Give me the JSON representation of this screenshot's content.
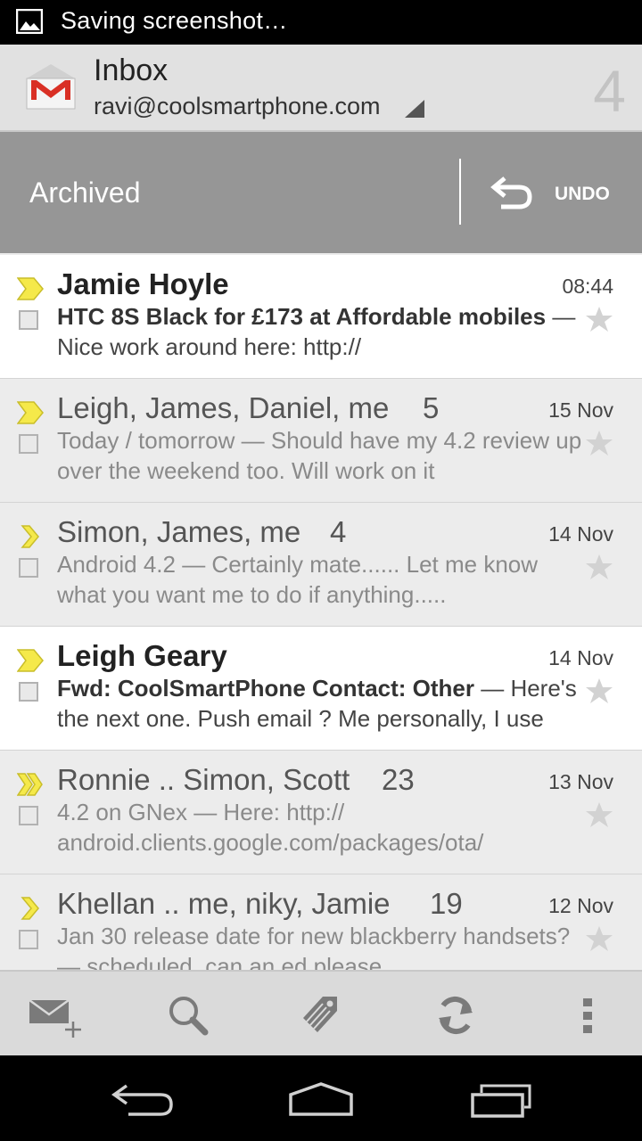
{
  "status_bar": {
    "notification_text": "Saving screenshot…"
  },
  "header": {
    "title": "Inbox",
    "account": "ravi@coolsmartphone.com",
    "unread_count": "4"
  },
  "undo_bar": {
    "message": "Archived",
    "undo_label": "UNDO"
  },
  "conversations": [
    {
      "sender": "Jamie Hoyle",
      "count": "",
      "date": "08:44",
      "subject": "HTC 8S Black for £173 at Affordable mobiles",
      "snippet": " — Nice work around here: http://",
      "unread": true,
      "importance": "single"
    },
    {
      "sender": "Leigh, James, Daniel, me",
      "count": "5",
      "date": "15 Nov",
      "subject": "Today / tomorrow",
      "snippet": " — Should have my 4.2 review up over the weekend too. Will work on it",
      "unread": false,
      "importance": "single"
    },
    {
      "sender": "Simon, James, me",
      "count": "4",
      "date": "14 Nov",
      "subject": "Android 4.2",
      "snippet": " — Certainly mate...... Let me know what you want me to do if anything.....",
      "unread": false,
      "importance": "outline"
    },
    {
      "sender": "Leigh Geary",
      "count": "",
      "date": "14 Nov",
      "subject": "Fwd: CoolSmartPhone Contact: Other",
      "snippet": " — Here's the next one. Push email ? Me personally, I use",
      "unread": true,
      "importance": "single"
    },
    {
      "sender": "Ronnie .. Simon, Scott",
      "count": "23",
      "date": "13 Nov",
      "subject": "4.2 on GNex",
      "snippet": " — Here: http:// android.clients.google.com/packages/ota/",
      "unread": false,
      "importance": "double"
    },
    {
      "sender": "Khellan .. me, niky, Jamie",
      "count": "19",
      "date": "12 Nov",
      "subject": "Jan 30 release date for new blackberry handsets?",
      "snippet": " — scheduled, can an ed please",
      "unread": false,
      "importance": "outline"
    }
  ],
  "bottom_toolbar": [
    "compose-icon",
    "search-icon",
    "labels-icon",
    "refresh-icon",
    "overflow-menu-icon"
  ],
  "system_nav": [
    "back-icon",
    "home-icon",
    "recent-apps-icon"
  ],
  "colors": {
    "importance_yellow": "#f5e94a",
    "undo_bar": "#969696",
    "gmail_red": "#d93025"
  }
}
